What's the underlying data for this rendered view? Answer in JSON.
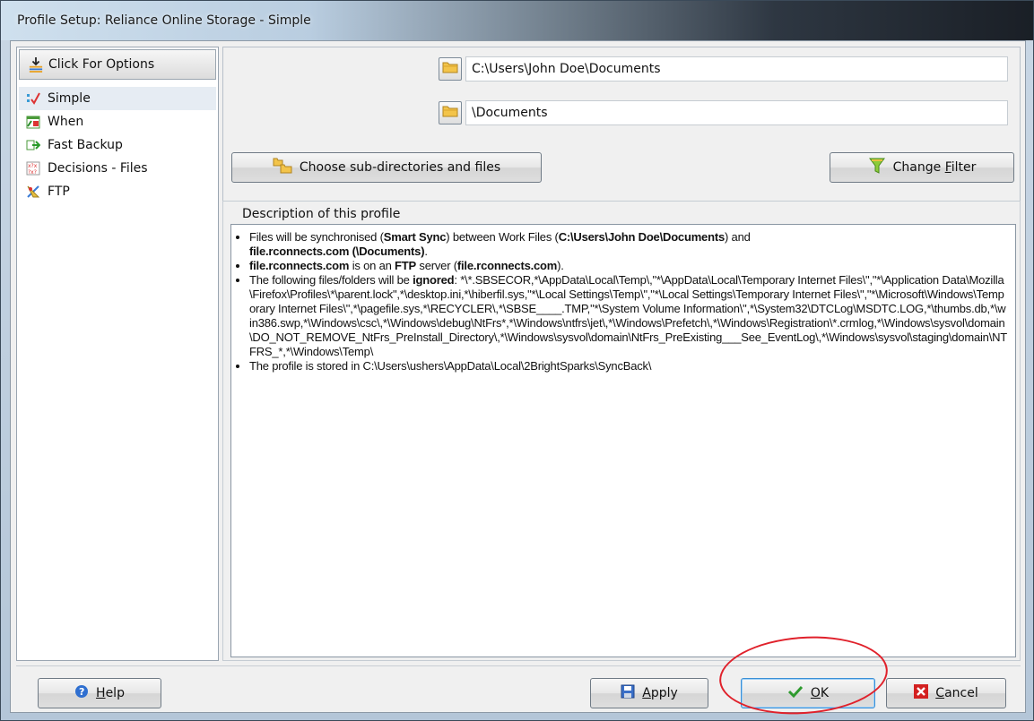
{
  "window": {
    "title": "Profile Setup: Reliance Online Storage - Simple"
  },
  "sidebar": {
    "options_label": "Click For Options",
    "items": [
      {
        "label": "Simple",
        "icon": "simple-icon",
        "selected": true
      },
      {
        "label": "When",
        "icon": "when-icon",
        "selected": false
      },
      {
        "label": "Fast Backup",
        "icon": "fast-backup-icon",
        "selected": false
      },
      {
        "label": "Decisions - Files",
        "icon": "decisions-icon",
        "selected": false
      },
      {
        "label": "FTP",
        "icon": "ftp-icon",
        "selected": false
      }
    ]
  },
  "paths": {
    "source": "C:\\Users\\John Doe\\Documents",
    "destination": "\\Documents"
  },
  "buttons": {
    "choose_subdirs": "Choose sub-directories and files",
    "change_filter_pre": "Change ",
    "change_filter_ul": "F",
    "change_filter_post": "ilter",
    "help_ul": "H",
    "help_post": "elp",
    "apply_ul": "A",
    "apply_post": "pply",
    "ok_ul": "O",
    "ok_post": "K",
    "cancel_ul": "C",
    "cancel_post": "ancel"
  },
  "description": {
    "label": "Description of this profile",
    "line1": {
      "t1": "Files will be synchronised (",
      "b1": "Smart Sync",
      "t2": ") between Work Files (",
      "b2": "C:\\Users\\John Doe\\Documents",
      "t3": ") and ",
      "b3": "file.rconnects.com (\\Documents)",
      "t4": "."
    },
    "line2": {
      "b1": "file.rconnects.com",
      "t1": " is on an ",
      "b2": "FTP",
      "t2": " server (",
      "b3": "file.rconnects.com",
      "t3": ")."
    },
    "line3": {
      "t1": "The following files/folders will be ",
      "b1": "ignored",
      "t2": ": *\\*.SBSECOR,*\\AppData\\Local\\Temp\\,\"*\\AppData\\Local\\Temporary Internet Files\\\",\"*\\Application Data\\Mozilla\\Firefox\\Profiles\\*\\parent.lock\",*\\desktop.ini,*\\hiberfil.sys,\"*\\Local Settings\\Temp\\\",\"*\\Local Settings\\Temporary Internet Files\\\",\"*\\Microsoft\\Windows\\Temporary Internet Files\\\",*\\pagefile.sys,*\\RECYCLER\\,*\\SBSE____.TMP,\"*\\System Volume Information\\\",*\\System32\\DTCLog\\MSDTC.LOG,*\\thumbs.db,*\\win386.swp,*\\Windows\\csc\\,*\\Windows\\debug\\NtFrs*,*\\Windows\\ntfrs\\jet\\,*\\Windows\\Prefetch\\,*\\Windows\\Registration\\*.crmlog,*\\Windows\\sysvol\\domain\\DO_NOT_REMOVE_NtFrs_PreInstall_Directory\\,*\\Windows\\sysvol\\domain\\NtFrs_PreExisting___See_EventLog\\,*\\Windows\\sysvol\\staging\\domain\\NTFRS_*,*\\Windows\\Temp\\"
    },
    "line4": "The profile is stored in C:\\Users\\ushers\\AppData\\Local\\2BrightSparks\\SyncBack\\"
  },
  "colors": {
    "highlight_circle": "#e0212b",
    "ok_check": "#2e9a2e",
    "cancel_x": "#d32020",
    "help_blue": "#2f6fd0"
  }
}
